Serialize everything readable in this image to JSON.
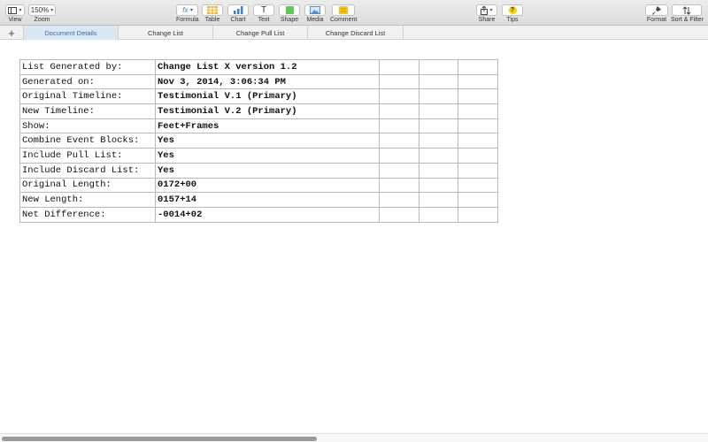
{
  "toolbar": {
    "view_label": "View",
    "zoom_value": "150%",
    "zoom_label": "Zoom",
    "formula_label": "Formula",
    "table_label": "Table",
    "chart_label": "Chart",
    "text_label": "Text",
    "shape_label": "Shape",
    "media_label": "Media",
    "comment_label": "Comment",
    "share_label": "Share",
    "tips_label": "Tips",
    "format_label": "Format",
    "sort_filter_label": "Sort & Filter",
    "formula_glyph": "fx",
    "text_glyph": "T",
    "tips_glyph": "?"
  },
  "tabs": [
    {
      "label": "Document Details",
      "active": true
    },
    {
      "label": "Change List",
      "active": false
    },
    {
      "label": "Change Pull List",
      "active": false
    },
    {
      "label": "Change Discard List",
      "active": false
    }
  ],
  "add_sheet_glyph": "+",
  "sheet": {
    "rows": [
      {
        "label": "List Generated by:",
        "value": "Change List X version 1.2"
      },
      {
        "label": "Generated on:",
        "value": "Nov 3, 2014, 3:06:34 PM"
      },
      {
        "label": "Original Timeline:",
        "value": "Testimonial V.1 (Primary)"
      },
      {
        "label": "New Timeline:",
        "value": "Testimonial V.2 (Primary)"
      },
      {
        "label": "Show:",
        "value": "Feet+Frames"
      },
      {
        "label": "Combine Event Blocks:",
        "value": "Yes"
      },
      {
        "label": "Include Pull List:",
        "value": "Yes"
      },
      {
        "label": "Include Discard List:",
        "value": "Yes"
      },
      {
        "label": "Original Length:",
        "value": "0172+00"
      },
      {
        "label": "New Length:",
        "value": "0157+14"
      },
      {
        "label": "Net Difference:",
        "value": "-0014+02"
      }
    ]
  },
  "colors": {
    "active_tab_bg": "#d9e6f4",
    "active_tab_text": "#3a6fb0",
    "table_icon": "#f2b233",
    "chart_icon": "#3f7fd4",
    "shape_icon": "#5ec85a",
    "media_icon": "#4a90d9",
    "comment_icon": "#f5c518",
    "tips_icon": "#f5d000"
  }
}
